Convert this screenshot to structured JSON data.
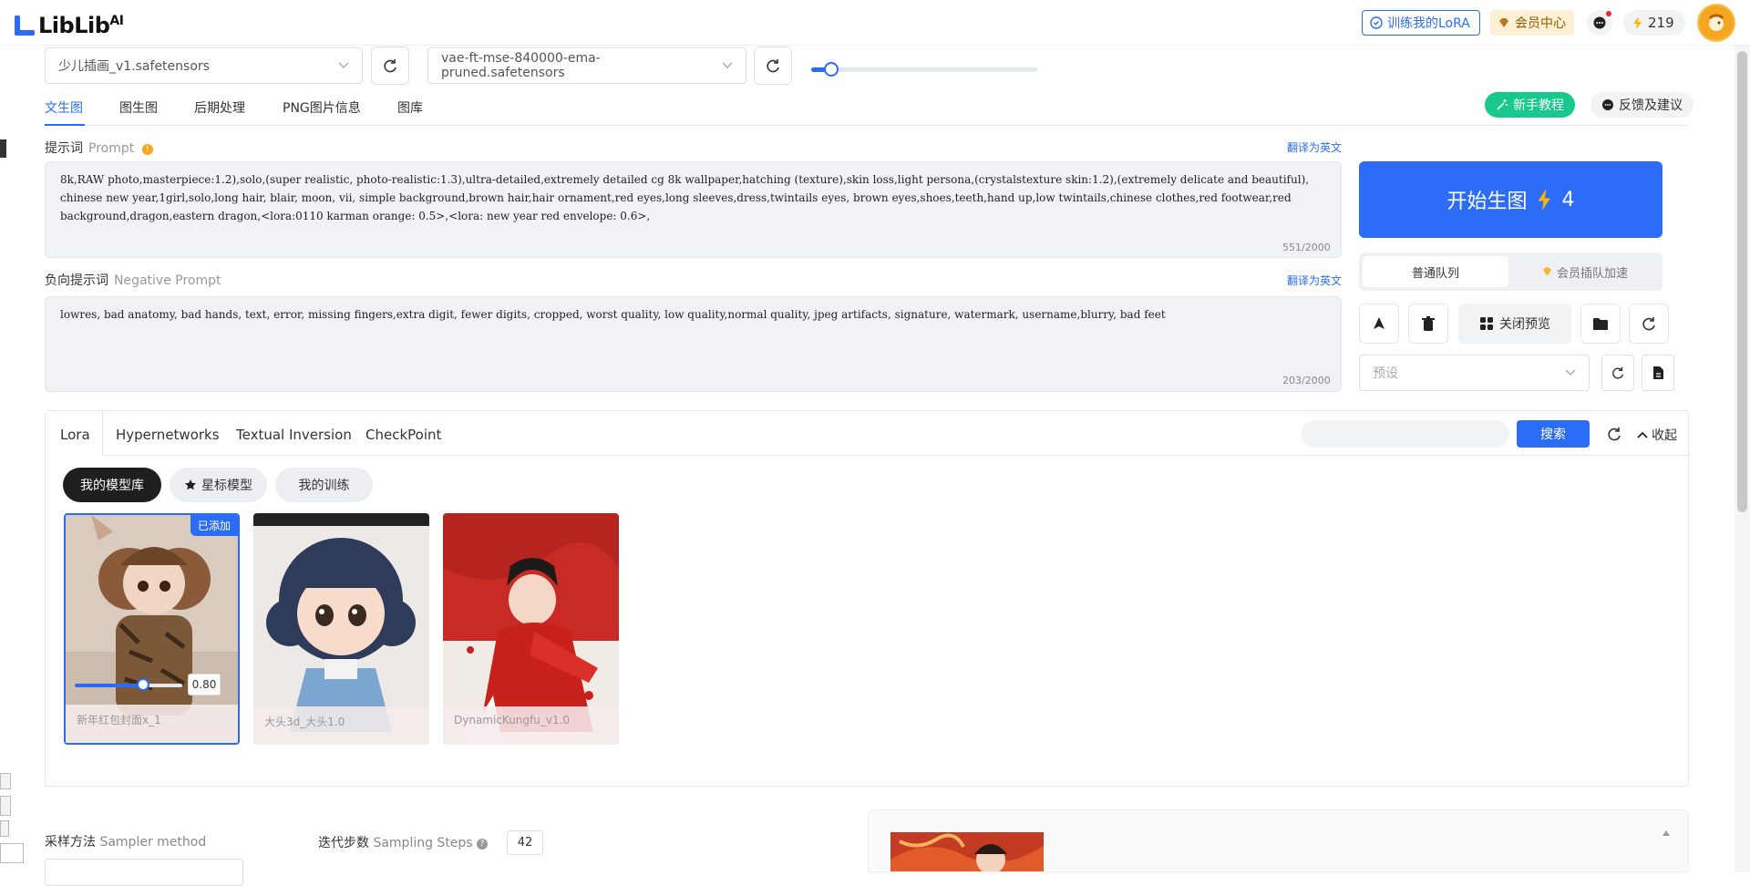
{
  "brand": {
    "name": "LibLib",
    "suffix": "AI"
  },
  "topbar": {
    "train_lora": "训练我的LoRA",
    "vip_center": "会员中心",
    "credits": "219"
  },
  "model": {
    "checkpoint": "少儿插画_v1.safetensors",
    "vae": "vae-ft-mse-840000-ema-pruned.safetensors",
    "clip_skip_fraction": 0.09
  },
  "tabs": [
    "文生图",
    "图生图",
    "后期处理",
    "PNG图片信息",
    "图库"
  ],
  "help": {
    "tutorial": "新手教程",
    "feedback": "反馈及建议"
  },
  "prompt": {
    "label": "提示词",
    "label_en": "Prompt",
    "translate": "翻译为英文",
    "text": "8k,RAW photo,masterpiece:1.2),solo,(super realistic, photo-realistic:1.3),ultra-detailed,extremely detailed cg 8k wallpaper,hatching (texture),skin loss,light persona,(crystalstexture skin:1.2),(extremely delicate and beautiful), chinese new year,1girl,solo,long hair, blair, moon, vii, simple background,brown hair,hair ornament,red eyes,long sleeves,dress,twintails eyes, brown eyes,shoes,teeth,hand up,low twintails,chinese clothes,red footwear,red background,dragon,eastern dragon,<lora:0110 karman orange: 0.5>,<lora: new year red envelope: 0.6>,",
    "count": "551/2000"
  },
  "negative": {
    "label": "负向提示词",
    "label_en": "Negative Prompt",
    "translate": "翻译为英文",
    "text": "lowres, bad anatomy, bad hands, text, error, missing fingers,extra digit, fewer digits, cropped, worst quality, low quality,normal quality, jpeg artifacts, signature, watermark, username,blurry, bad feet",
    "count": "203/2000"
  },
  "generate": {
    "label": "开始生图",
    "cost": "4"
  },
  "queue": {
    "normal": "普通队列",
    "vip": "会员插队加速"
  },
  "actions": {
    "close_preview": "关闭预览"
  },
  "preset": {
    "placeholder": "预设"
  },
  "lora_panel": {
    "tabs": [
      "Lora",
      "Hypernetworks",
      "Textual Inversion",
      "CheckPoint"
    ],
    "search": "搜索",
    "collapse": "收起",
    "chips": [
      "我的模型库",
      "星标模型",
      "我的训练"
    ],
    "cards": [
      {
        "name": "新年红包封面x_1",
        "badge": "已添加",
        "weight": "0.80",
        "weight_fraction": 0.8
      },
      {
        "name": "大头3d_大头1.0"
      },
      {
        "name": "DynamicKungfu_v1.0"
      }
    ]
  },
  "sampler": {
    "label": "采样方法",
    "label_en": "Sampler method"
  },
  "steps": {
    "label": "迭代步数",
    "label_en": "Sampling Steps",
    "value": "42"
  }
}
